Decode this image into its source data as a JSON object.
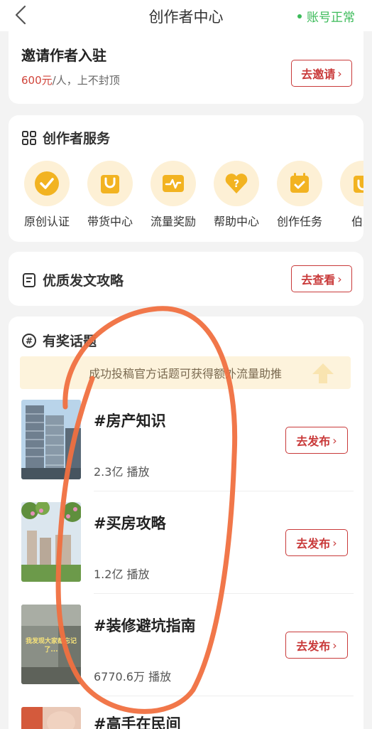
{
  "header": {
    "title": "创作者中心",
    "status": "账号正常"
  },
  "invite": {
    "title": "邀请作者入驻",
    "amount": "600元",
    "rest": "/人，上不封顶",
    "button": "去邀请"
  },
  "services": {
    "title": "创作者服务",
    "items": [
      {
        "label": "原创认证",
        "icon": "check-badge-icon"
      },
      {
        "label": "带货中心",
        "icon": "shopping-bag-icon"
      },
      {
        "label": "流量奖励",
        "icon": "traffic-chart-icon"
      },
      {
        "label": "帮助中心",
        "icon": "help-heart-icon"
      },
      {
        "label": "创作任务",
        "icon": "task-calendar-icon"
      },
      {
        "label": "伯乐",
        "icon": "partial-icon"
      }
    ]
  },
  "guide": {
    "title": "优质发文攻略",
    "button": "去查看"
  },
  "topics": {
    "title": "有奖话题",
    "banner": "成功投稿官方话题可获得额外流量助推",
    "button": "去发布",
    "items": [
      {
        "name": "#房产知识",
        "views": "2.3亿 播放"
      },
      {
        "name": "#买房攻略",
        "views": "1.2亿 播放"
      },
      {
        "name": "#装修避坑指南",
        "views": "6770.6万 播放"
      },
      {
        "name": "#高手在民间",
        "views": ""
      }
    ],
    "thumb_caption": "我发现大家都忘记了..."
  },
  "colors": {
    "accent": "#c93a3a",
    "status": "#3cbb5a",
    "iconBg": "#fdf0d5",
    "iconFg": "#e8a21a",
    "annotation": "#f07040"
  }
}
